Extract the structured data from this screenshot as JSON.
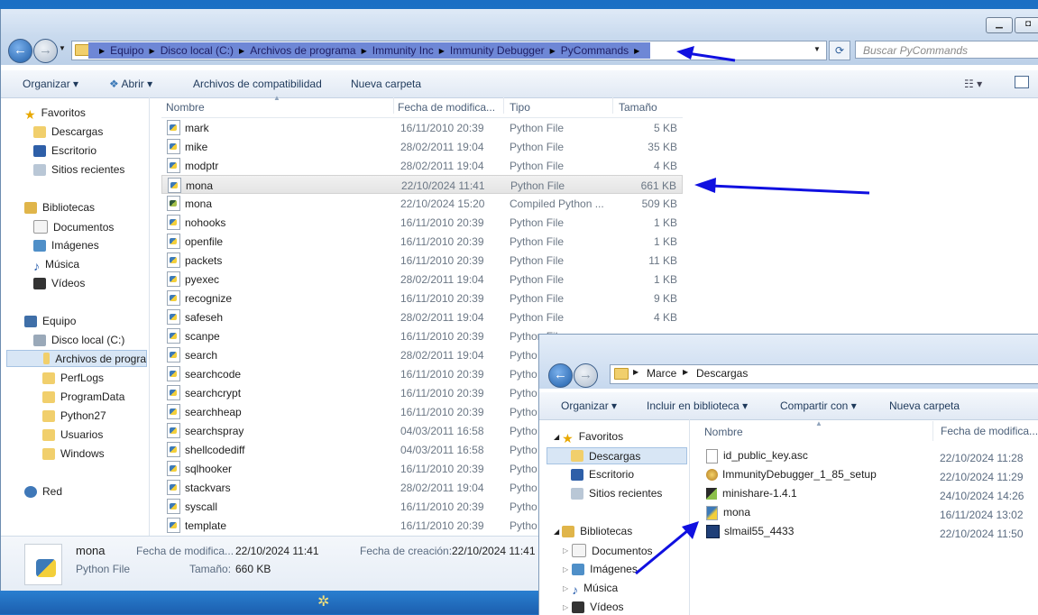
{
  "main_window": {
    "address": {
      "crumbs": [
        "Equipo",
        "Disco local (C:)",
        "Archivos de programa",
        "Immunity Inc",
        "Immunity Debugger",
        "PyCommands"
      ]
    },
    "search_placeholder": "Buscar PyCommands",
    "toolbar": {
      "organize": "Organizar",
      "open": "Abrir",
      "compat": "Archivos de compatibilidad",
      "new_folder": "Nueva carpeta"
    },
    "nav": {
      "favorites": "Favoritos",
      "downloads": "Descargas",
      "desktop": "Escritorio",
      "recent": "Sitios recientes",
      "libraries": "Bibliotecas",
      "documents": "Documentos",
      "images": "Imágenes",
      "music": "Música",
      "videos": "Vídeos",
      "computer": "Equipo",
      "local_disk": "Disco local (C:)",
      "program_files": "Archivos de progra",
      "perflogs": "PerfLogs",
      "programdata": "ProgramData",
      "python27": "Python27",
      "users": "Usuarios",
      "windows": "Windows",
      "network": "Red"
    },
    "columns": {
      "name": "Nombre",
      "modified": "Fecha de modifica...",
      "type": "Tipo",
      "size": "Tamaño"
    },
    "files": [
      {
        "name": "mark",
        "date": "16/11/2010 20:39",
        "type": "Python File",
        "size": "5 KB"
      },
      {
        "name": "mike",
        "date": "28/02/2011 19:04",
        "type": "Python File",
        "size": "35 KB"
      },
      {
        "name": "modptr",
        "date": "28/02/2011 19:04",
        "type": "Python File",
        "size": "4 KB"
      },
      {
        "name": "mona",
        "date": "22/10/2024 11:41",
        "type": "Python File",
        "size": "661 KB"
      },
      {
        "name": "mona",
        "date": "22/10/2024 15:20",
        "type": "Compiled Python ...",
        "size": "509 KB"
      },
      {
        "name": "nohooks",
        "date": "16/11/2010 20:39",
        "type": "Python File",
        "size": "1 KB"
      },
      {
        "name": "openfile",
        "date": "16/11/2010 20:39",
        "type": "Python File",
        "size": "1 KB"
      },
      {
        "name": "packets",
        "date": "16/11/2010 20:39",
        "type": "Python File",
        "size": "11 KB"
      },
      {
        "name": "pyexec",
        "date": "28/02/2011 19:04",
        "type": "Python File",
        "size": "1 KB"
      },
      {
        "name": "recognize",
        "date": "16/11/2010 20:39",
        "type": "Python File",
        "size": "9 KB"
      },
      {
        "name": "safeseh",
        "date": "28/02/2011 19:04",
        "type": "Python File",
        "size": "4 KB"
      },
      {
        "name": "scanpe",
        "date": "16/11/2010 20:39",
        "type": "Python File",
        "size": ""
      },
      {
        "name": "search",
        "date": "28/02/2011 19:04",
        "type": "Pytho",
        "size": ""
      },
      {
        "name": "searchcode",
        "date": "16/11/2010 20:39",
        "type": "Pytho",
        "size": ""
      },
      {
        "name": "searchcrypt",
        "date": "16/11/2010 20:39",
        "type": "Pytho",
        "size": ""
      },
      {
        "name": "searchheap",
        "date": "16/11/2010 20:39",
        "type": "Pytho",
        "size": ""
      },
      {
        "name": "searchspray",
        "date": "04/03/2011 16:58",
        "type": "Pytho",
        "size": ""
      },
      {
        "name": "shellcodediff",
        "date": "04/03/2011 16:58",
        "type": "Pytho",
        "size": ""
      },
      {
        "name": "sqlhooker",
        "date": "16/11/2010 20:39",
        "type": "Pytho",
        "size": ""
      },
      {
        "name": "stackvars",
        "date": "28/02/2011 19:04",
        "type": "Pytho",
        "size": ""
      },
      {
        "name": "syscall",
        "date": "16/11/2010 20:39",
        "type": "Pytho",
        "size": ""
      },
      {
        "name": "template",
        "date": "16/11/2010 20:39",
        "type": "Pytho",
        "size": ""
      }
    ],
    "status": {
      "name": "mona",
      "type": "Python File",
      "modified_label": "Fecha de modifica...",
      "modified": "22/10/2024 11:41",
      "created_label": "Fecha de creación:",
      "created": "22/10/2024 11:41",
      "size_label": "Tamaño:",
      "size": "660 KB"
    }
  },
  "downloads_window": {
    "crumbs": [
      "Marce",
      "Descargas"
    ],
    "toolbar": {
      "organize": "Organizar",
      "include": "Incluir en biblioteca",
      "share": "Compartir con",
      "new_folder": "Nueva carpeta"
    },
    "nav": {
      "favorites": "Favoritos",
      "downloads": "Descargas",
      "desktop": "Escritorio",
      "recent": "Sitios recientes",
      "libraries": "Bibliotecas",
      "documents": "Documentos",
      "images": "Imágenes",
      "music": "Música",
      "videos": "Vídeos"
    },
    "columns": {
      "name": "Nombre",
      "modified": "Fecha de modifica..."
    },
    "files": [
      {
        "name": "id_public_key.asc",
        "date": "22/10/2024 11:28"
      },
      {
        "name": "ImmunityDebugger_1_85_setup",
        "date": "22/10/2024 11:29"
      },
      {
        "name": "minishare-1.4.1",
        "date": "24/10/2024 14:26"
      },
      {
        "name": "mona",
        "date": "16/11/2024 13:02"
      },
      {
        "name": "slmail55_4433",
        "date": "22/10/2024 11:50"
      }
    ]
  },
  "colors": {
    "annotation_arrow": "#1010e0",
    "address_highlight": "#6e87d6"
  }
}
